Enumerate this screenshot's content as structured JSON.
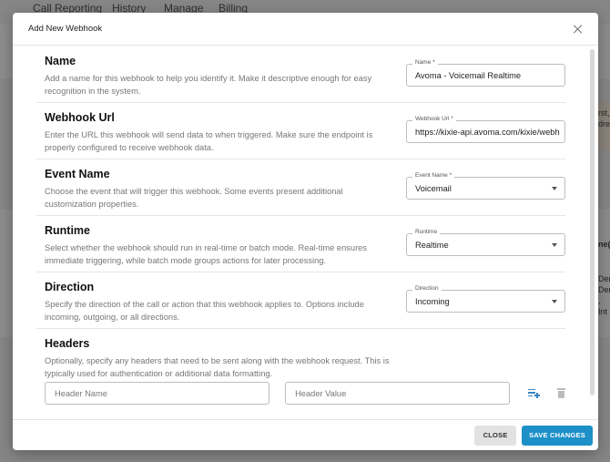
{
  "background_nav": [
    "Call Reporting",
    "History",
    "Manage",
    "Billing"
  ],
  "background_fragments": [
    "rst,",
    "dre",
    "ne(",
    "Den",
    "Den",
    ", Int"
  ],
  "modal": {
    "title": "Add New Webhook",
    "sections": [
      {
        "heading": "Name",
        "description": "Add a name for this webhook to help you identify it. Make it descriptive enough for easy recognition in the system.",
        "field_label": "Name *",
        "field_value": "Avoma - Voicemail Realtime"
      },
      {
        "heading": "Webhook Url",
        "description": "Enter the URL this webhook will send data to when triggered. Make sure the endpoint is properly configured to receive webhook data.",
        "field_label": "Webhook Url *",
        "field_value": "https://kixie-api.avoma.com/kixie/webh"
      },
      {
        "heading": "Event Name",
        "description": "Choose the event that will trigger this webhook. Some events present additional customization properties.",
        "field_label": "Event Name *",
        "field_value": "Voicemail"
      },
      {
        "heading": "Runtime",
        "description": "Select whether the webhook should run in real-time or batch mode. Real-time ensures immediate triggering, while batch mode groups actions for later processing.",
        "field_label": "Runtime",
        "field_value": "Realtime"
      },
      {
        "heading": "Direction",
        "description": "Specify the direction of the call or action that this webhook applies to. Options include incoming, outgoing, or all directions.",
        "field_label": "Direction",
        "field_value": "Incoming"
      }
    ],
    "headers": {
      "heading": "Headers",
      "description": "Optionally, specify any headers that need to be sent along with the webhook request. This is typically used for authentication or additional data formatting.",
      "name_placeholder": "Header Name",
      "value_placeholder": "Header Value"
    },
    "footer": {
      "close_label": "CLOSE",
      "save_label": "SAVE CHANGES"
    }
  },
  "colors": {
    "primary": "#1e90c8",
    "add_icon": "#3a86c8"
  }
}
